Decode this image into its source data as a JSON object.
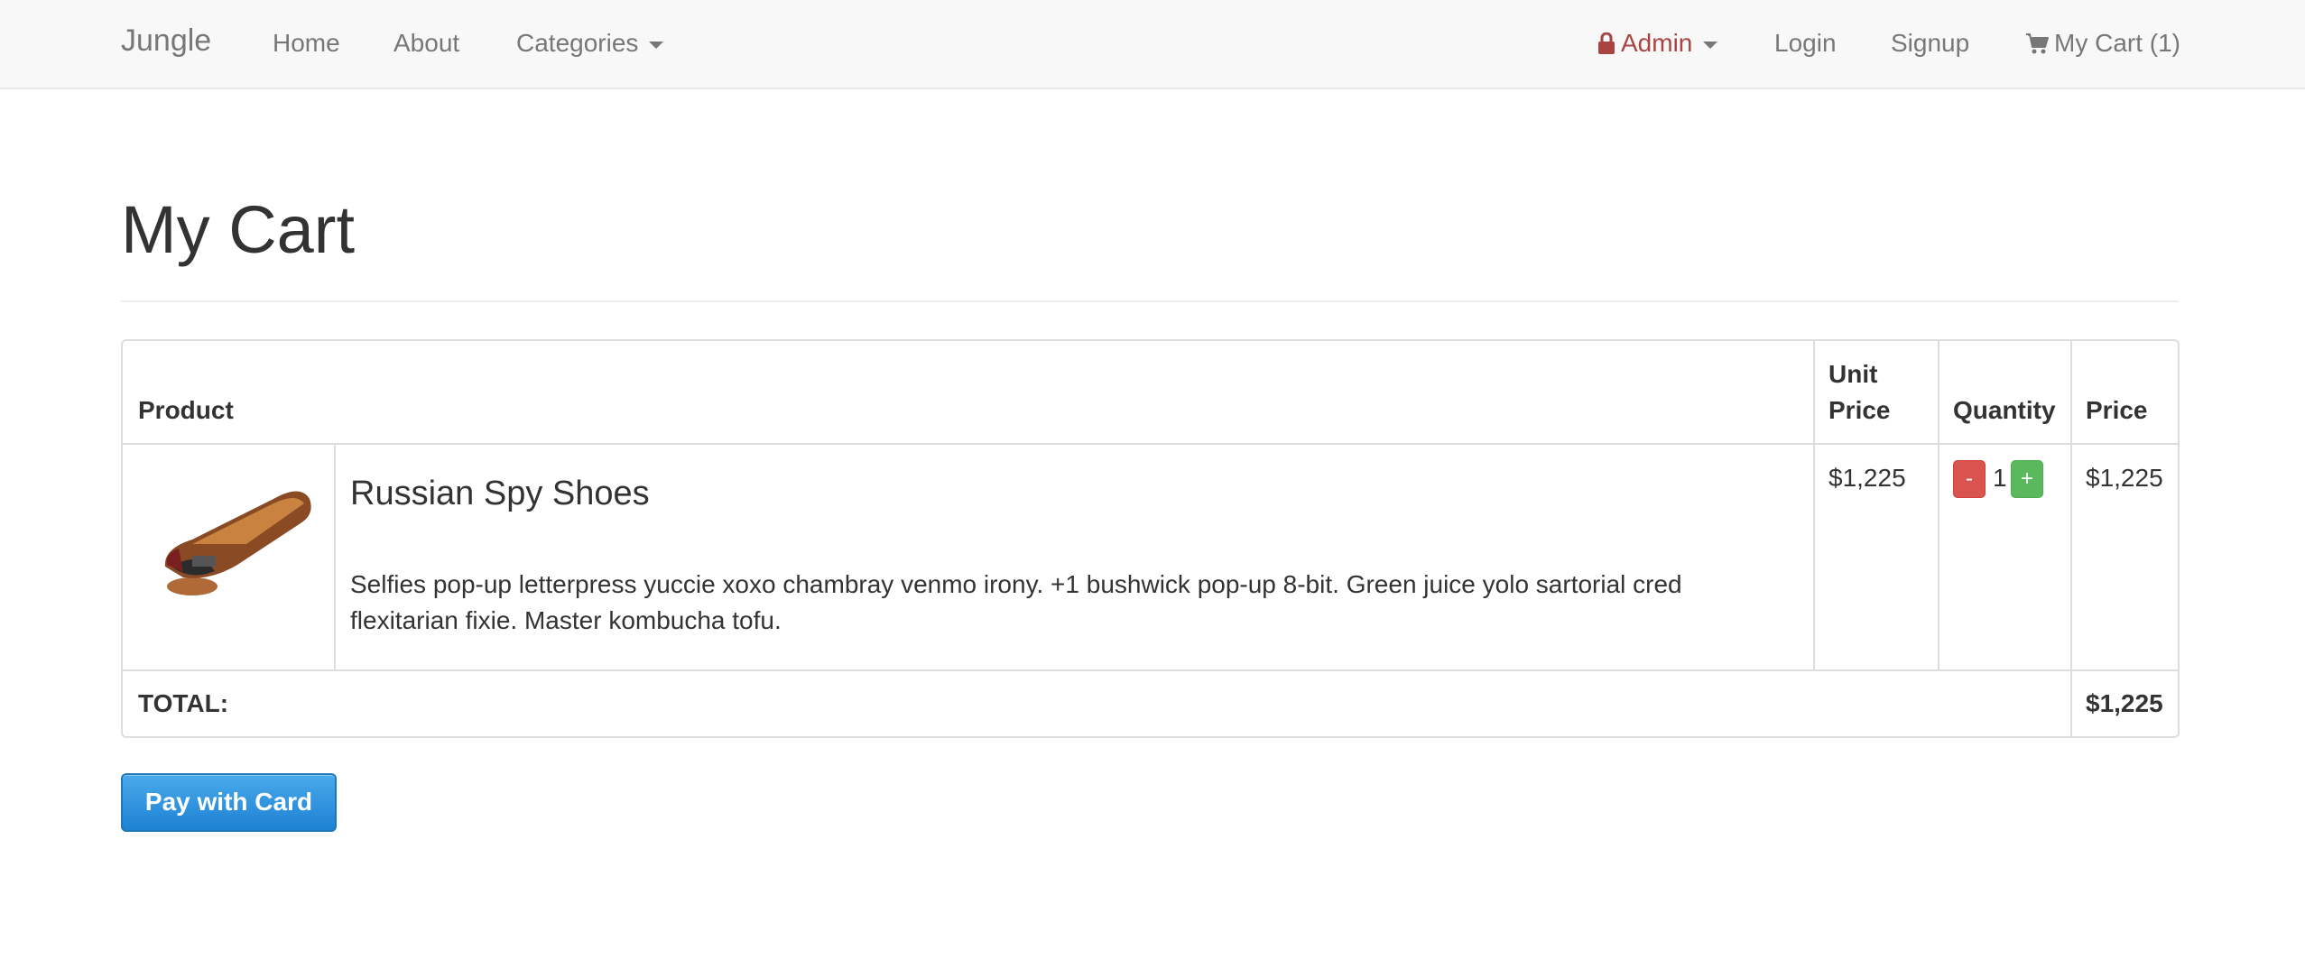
{
  "navbar": {
    "brand": "Jungle",
    "links": {
      "home": "Home",
      "about": "About",
      "categories": "Categories"
    },
    "admin": "Admin",
    "login": "Login",
    "signup": "Signup",
    "cart": "My Cart (1)"
  },
  "page": {
    "title": "My Cart"
  },
  "table": {
    "headers": {
      "product": "Product",
      "unit_price_line1": "Unit",
      "unit_price_line2": "Price",
      "quantity": "Quantity",
      "price": "Price"
    },
    "items": [
      {
        "name": "Russian Spy Shoes",
        "description": "Selfies pop-up letterpress yuccie xoxo chambray venmo irony. +1 bushwick pop-up 8-bit. Green juice yolo sartorial cred flexitarian fixie. Master kombucha tofu.",
        "unit_price": "$1,225",
        "quantity": "1",
        "price": "$1,225",
        "minus": "-",
        "plus": "+"
      }
    ],
    "total_label": "TOTAL:",
    "total_value": "$1,225"
  },
  "actions": {
    "pay": "Pay with Card"
  },
  "colors": {
    "admin": "#a94442",
    "minus_button": "#d9534f",
    "plus_button": "#5cb85c",
    "pay_button": "#1e82d4"
  },
  "icons": {
    "admin": "lock-icon",
    "cart": "shopping-cart-icon",
    "dropdown": "caret-down-icon"
  }
}
